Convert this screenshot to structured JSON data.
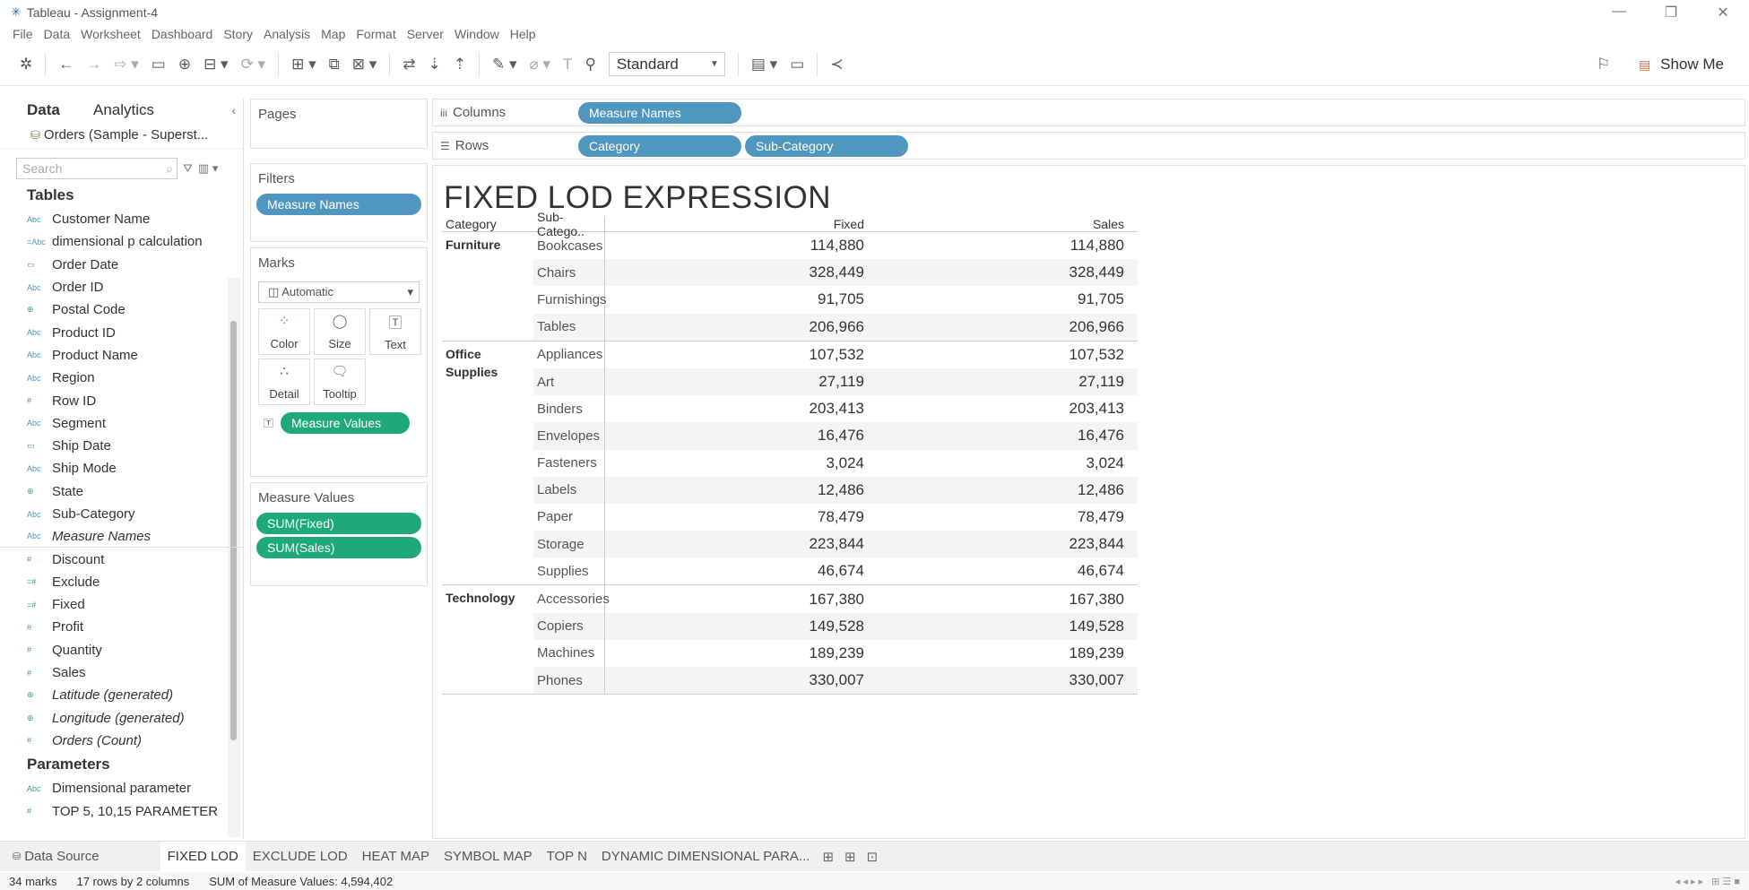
{
  "window": {
    "title": "Tableau - Assignment-4",
    "controls": [
      "—",
      "❐",
      "✕"
    ]
  },
  "menu": [
    "File",
    "Data",
    "Worksheet",
    "Dashboard",
    "Story",
    "Analysis",
    "Map",
    "Format",
    "Server",
    "Window",
    "Help"
  ],
  "toolbar": {
    "fit_mode": "Standard",
    "show_me": "Show Me"
  },
  "data_pane": {
    "tabs": {
      "data": "Data",
      "analytics": "Analytics"
    },
    "datasource": "Orders (Sample - Superst...",
    "search_placeholder": "Search",
    "tables_header": "Tables",
    "dimensions": [
      {
        "type": "Abc",
        "name": "Customer Name"
      },
      {
        "type": "=Abc",
        "name": "dimensional p calculation"
      },
      {
        "type": "date",
        "name": "Order Date"
      },
      {
        "type": "Abc",
        "name": "Order ID"
      },
      {
        "type": "geo",
        "name": "Postal Code"
      },
      {
        "type": "Abc",
        "name": "Product ID"
      },
      {
        "type": "Abc",
        "name": "Product Name"
      },
      {
        "type": "Abc",
        "name": "Region"
      },
      {
        "type": "#",
        "name": "Row ID"
      },
      {
        "type": "Abc",
        "name": "Segment"
      },
      {
        "type": "date",
        "name": "Ship Date"
      },
      {
        "type": "Abc",
        "name": "Ship Mode"
      },
      {
        "type": "geo",
        "name": "State"
      },
      {
        "type": "Abc",
        "name": "Sub-Category"
      },
      {
        "type": "Abc",
        "name": "Measure Names",
        "italic": true
      }
    ],
    "measures": [
      {
        "type": "#",
        "name": "Discount"
      },
      {
        "type": "=#",
        "name": "Exclude"
      },
      {
        "type": "=#",
        "name": "Fixed"
      },
      {
        "type": "#",
        "name": "Profit"
      },
      {
        "type": "#",
        "name": "Quantity"
      },
      {
        "type": "#",
        "name": "Sales"
      },
      {
        "type": "geo",
        "name": "Latitude (generated)",
        "italic": true
      },
      {
        "type": "geo",
        "name": "Longitude (generated)",
        "italic": true
      },
      {
        "type": "#",
        "name": "Orders (Count)",
        "italic": true
      }
    ],
    "parameters_header": "Parameters",
    "parameters": [
      {
        "type": "Abc",
        "name": "Dimensional parameter"
      },
      {
        "type": "#",
        "name": "TOP 5, 10,15 PARAMETER"
      }
    ]
  },
  "cards": {
    "pages": "Pages",
    "filters": "Filters",
    "filter_pill": "Measure Names",
    "marks": "Marks",
    "mark_type": "Automatic",
    "mark_buttons": [
      "Color",
      "Size",
      "Text",
      "Detail",
      "Tooltip"
    ],
    "marks_pill": "Measure Values",
    "measure_values": "Measure Values",
    "mv_pills": [
      "SUM(Fixed)",
      "SUM(Sales)"
    ]
  },
  "shelves": {
    "columns_label": "Columns",
    "columns_pills": [
      "Measure Names"
    ],
    "rows_label": "Rows",
    "rows_pills": [
      "Category",
      "Sub-Category"
    ]
  },
  "viz": {
    "title": "FIXED LOD EXPRESSION",
    "headers": {
      "category": "Category",
      "subcategory": "Sub-Catego..",
      "fixed": "Fixed",
      "sales": "Sales"
    },
    "groups": [
      {
        "category": "Furniture",
        "rows": [
          {
            "sub": "Bookcases",
            "fixed": "114,880",
            "sales": "114,880"
          },
          {
            "sub": "Chairs",
            "fixed": "328,449",
            "sales": "328,449"
          },
          {
            "sub": "Furnishings",
            "fixed": "91,705",
            "sales": "91,705"
          },
          {
            "sub": "Tables",
            "fixed": "206,966",
            "sales": "206,966"
          }
        ]
      },
      {
        "category": "Office Supplies",
        "rows": [
          {
            "sub": "Appliances",
            "fixed": "107,532",
            "sales": "107,532"
          },
          {
            "sub": "Art",
            "fixed": "27,119",
            "sales": "27,119"
          },
          {
            "sub": "Binders",
            "fixed": "203,413",
            "sales": "203,413"
          },
          {
            "sub": "Envelopes",
            "fixed": "16,476",
            "sales": "16,476"
          },
          {
            "sub": "Fasteners",
            "fixed": "3,024",
            "sales": "3,024"
          },
          {
            "sub": "Labels",
            "fixed": "12,486",
            "sales": "12,486"
          },
          {
            "sub": "Paper",
            "fixed": "78,479",
            "sales": "78,479"
          },
          {
            "sub": "Storage",
            "fixed": "223,844",
            "sales": "223,844"
          },
          {
            "sub": "Supplies",
            "fixed": "46,674",
            "sales": "46,674"
          }
        ]
      },
      {
        "category": "Technology",
        "rows": [
          {
            "sub": "Accessories",
            "fixed": "167,380",
            "sales": "167,380"
          },
          {
            "sub": "Copiers",
            "fixed": "149,528",
            "sales": "149,528"
          },
          {
            "sub": "Machines",
            "fixed": "189,239",
            "sales": "189,239"
          },
          {
            "sub": "Phones",
            "fixed": "330,007",
            "sales": "330,007"
          }
        ]
      }
    ]
  },
  "sheet_tabs": {
    "data_source": "Data Source",
    "tabs": [
      "FIXED LOD",
      "EXCLUDE LOD",
      "HEAT MAP",
      "SYMBOL MAP",
      "TOP N",
      "DYNAMIC DIMENSIONAL PARA..."
    ],
    "active": "FIXED LOD"
  },
  "status": {
    "marks": "34 marks",
    "dims": "17 rows by 2 columns",
    "sum": "SUM of Measure Values: 4,594,402"
  }
}
